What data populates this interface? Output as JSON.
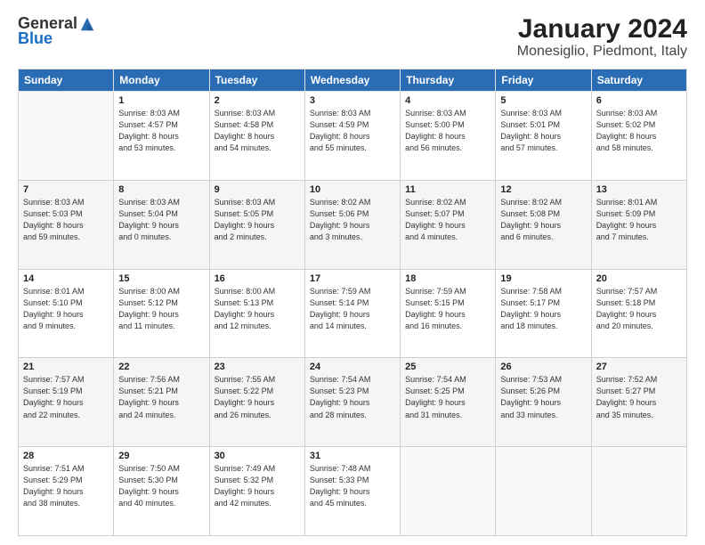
{
  "header": {
    "logo_general": "General",
    "logo_blue": "Blue",
    "month": "January 2024",
    "location": "Monesiglio, Piedmont, Italy"
  },
  "weekdays": [
    "Sunday",
    "Monday",
    "Tuesday",
    "Wednesday",
    "Thursday",
    "Friday",
    "Saturday"
  ],
  "weeks": [
    [
      {
        "day": "",
        "info": ""
      },
      {
        "day": "1",
        "info": "Sunrise: 8:03 AM\nSunset: 4:57 PM\nDaylight: 8 hours\nand 53 minutes."
      },
      {
        "day": "2",
        "info": "Sunrise: 8:03 AM\nSunset: 4:58 PM\nDaylight: 8 hours\nand 54 minutes."
      },
      {
        "day": "3",
        "info": "Sunrise: 8:03 AM\nSunset: 4:59 PM\nDaylight: 8 hours\nand 55 minutes."
      },
      {
        "day": "4",
        "info": "Sunrise: 8:03 AM\nSunset: 5:00 PM\nDaylight: 8 hours\nand 56 minutes."
      },
      {
        "day": "5",
        "info": "Sunrise: 8:03 AM\nSunset: 5:01 PM\nDaylight: 8 hours\nand 57 minutes."
      },
      {
        "day": "6",
        "info": "Sunrise: 8:03 AM\nSunset: 5:02 PM\nDaylight: 8 hours\nand 58 minutes."
      }
    ],
    [
      {
        "day": "7",
        "info": "Sunrise: 8:03 AM\nSunset: 5:03 PM\nDaylight: 8 hours\nand 59 minutes."
      },
      {
        "day": "8",
        "info": "Sunrise: 8:03 AM\nSunset: 5:04 PM\nDaylight: 9 hours\nand 0 minutes."
      },
      {
        "day": "9",
        "info": "Sunrise: 8:03 AM\nSunset: 5:05 PM\nDaylight: 9 hours\nand 2 minutes."
      },
      {
        "day": "10",
        "info": "Sunrise: 8:02 AM\nSunset: 5:06 PM\nDaylight: 9 hours\nand 3 minutes."
      },
      {
        "day": "11",
        "info": "Sunrise: 8:02 AM\nSunset: 5:07 PM\nDaylight: 9 hours\nand 4 minutes."
      },
      {
        "day": "12",
        "info": "Sunrise: 8:02 AM\nSunset: 5:08 PM\nDaylight: 9 hours\nand 6 minutes."
      },
      {
        "day": "13",
        "info": "Sunrise: 8:01 AM\nSunset: 5:09 PM\nDaylight: 9 hours\nand 7 minutes."
      }
    ],
    [
      {
        "day": "14",
        "info": "Sunrise: 8:01 AM\nSunset: 5:10 PM\nDaylight: 9 hours\nand 9 minutes."
      },
      {
        "day": "15",
        "info": "Sunrise: 8:00 AM\nSunset: 5:12 PM\nDaylight: 9 hours\nand 11 minutes."
      },
      {
        "day": "16",
        "info": "Sunrise: 8:00 AM\nSunset: 5:13 PM\nDaylight: 9 hours\nand 12 minutes."
      },
      {
        "day": "17",
        "info": "Sunrise: 7:59 AM\nSunset: 5:14 PM\nDaylight: 9 hours\nand 14 minutes."
      },
      {
        "day": "18",
        "info": "Sunrise: 7:59 AM\nSunset: 5:15 PM\nDaylight: 9 hours\nand 16 minutes."
      },
      {
        "day": "19",
        "info": "Sunrise: 7:58 AM\nSunset: 5:17 PM\nDaylight: 9 hours\nand 18 minutes."
      },
      {
        "day": "20",
        "info": "Sunrise: 7:57 AM\nSunset: 5:18 PM\nDaylight: 9 hours\nand 20 minutes."
      }
    ],
    [
      {
        "day": "21",
        "info": "Sunrise: 7:57 AM\nSunset: 5:19 PM\nDaylight: 9 hours\nand 22 minutes."
      },
      {
        "day": "22",
        "info": "Sunrise: 7:56 AM\nSunset: 5:21 PM\nDaylight: 9 hours\nand 24 minutes."
      },
      {
        "day": "23",
        "info": "Sunrise: 7:55 AM\nSunset: 5:22 PM\nDaylight: 9 hours\nand 26 minutes."
      },
      {
        "day": "24",
        "info": "Sunrise: 7:54 AM\nSunset: 5:23 PM\nDaylight: 9 hours\nand 28 minutes."
      },
      {
        "day": "25",
        "info": "Sunrise: 7:54 AM\nSunset: 5:25 PM\nDaylight: 9 hours\nand 31 minutes."
      },
      {
        "day": "26",
        "info": "Sunrise: 7:53 AM\nSunset: 5:26 PM\nDaylight: 9 hours\nand 33 minutes."
      },
      {
        "day": "27",
        "info": "Sunrise: 7:52 AM\nSunset: 5:27 PM\nDaylight: 9 hours\nand 35 minutes."
      }
    ],
    [
      {
        "day": "28",
        "info": "Sunrise: 7:51 AM\nSunset: 5:29 PM\nDaylight: 9 hours\nand 38 minutes."
      },
      {
        "day": "29",
        "info": "Sunrise: 7:50 AM\nSunset: 5:30 PM\nDaylight: 9 hours\nand 40 minutes."
      },
      {
        "day": "30",
        "info": "Sunrise: 7:49 AM\nSunset: 5:32 PM\nDaylight: 9 hours\nand 42 minutes."
      },
      {
        "day": "31",
        "info": "Sunrise: 7:48 AM\nSunset: 5:33 PM\nDaylight: 9 hours\nand 45 minutes."
      },
      {
        "day": "",
        "info": ""
      },
      {
        "day": "",
        "info": ""
      },
      {
        "day": "",
        "info": ""
      }
    ]
  ]
}
